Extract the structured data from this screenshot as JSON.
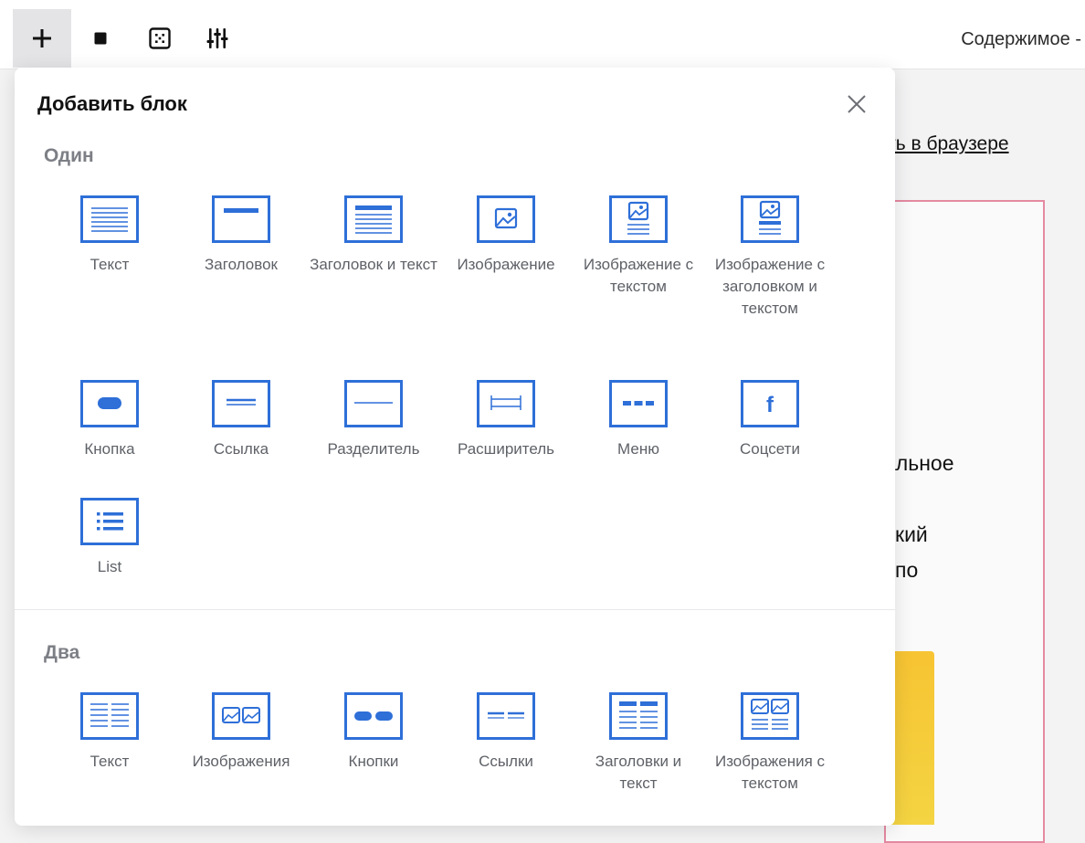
{
  "toolbar": {
    "content_label": "Содержимое -",
    "buttons": [
      {
        "icon": "plus-icon"
      },
      {
        "icon": "square-icon"
      },
      {
        "icon": "grid-icon"
      },
      {
        "icon": "sliders-icon"
      }
    ]
  },
  "document": {
    "link_text": "ыть в браузере",
    "text_lines": [
      "альное",
      "кий",
      "по"
    ]
  },
  "dialog": {
    "title": "Добавить блок",
    "sections": [
      {
        "title": "Один",
        "blocks": [
          {
            "label": "Текст",
            "icon": "text-icon"
          },
          {
            "label": "Заголовок",
            "icon": "heading-icon"
          },
          {
            "label": "Заголовок и текст",
            "icon": "heading-text-icon"
          },
          {
            "label": "Изображение",
            "icon": "image-icon"
          },
          {
            "label": "Изображение с текстом",
            "icon": "image-text-icon"
          },
          {
            "label": "Изображение с заголовком и текстом",
            "icon": "image-heading-text-icon"
          },
          {
            "label": "Кнопка",
            "icon": "button-icon"
          },
          {
            "label": "Ссылка",
            "icon": "link-icon"
          },
          {
            "label": "Разделитель",
            "icon": "divider-icon"
          },
          {
            "label": "Расширитель",
            "icon": "spacer-icon"
          },
          {
            "label": "Меню",
            "icon": "menu-icon"
          },
          {
            "label": "Соцсети",
            "icon": "social-icon"
          },
          {
            "label": "List",
            "icon": "list-icon"
          }
        ]
      },
      {
        "title": "Два",
        "blocks": [
          {
            "label": "Текст",
            "icon": "two-text-icon"
          },
          {
            "label": "Изображения",
            "icon": "two-images-icon"
          },
          {
            "label": "Кнопки",
            "icon": "two-buttons-icon"
          },
          {
            "label": "Ссылки",
            "icon": "two-links-icon"
          },
          {
            "label": "Заголовки и текст",
            "icon": "two-heading-text-icon"
          },
          {
            "label": "Изображения с текстом",
            "icon": "two-images-text-icon"
          }
        ]
      }
    ]
  },
  "colors": {
    "accent": "#2e6fd8",
    "section_title": "#7d7f86",
    "label": "#5e6167",
    "frame": "#e48aa1",
    "yellow": "#f5cc3a"
  }
}
